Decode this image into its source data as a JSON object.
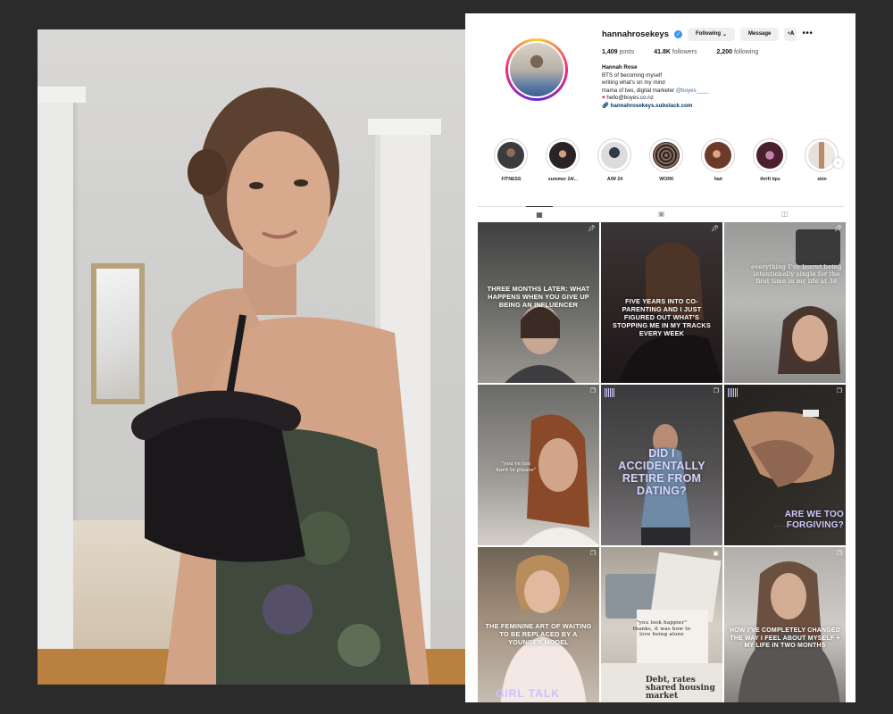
{
  "profile": {
    "username": "hannahrosekeys",
    "following_button": "Following",
    "message_button": "Message",
    "add_person_icon": "add-person",
    "more_icon": "•••",
    "posts_count": "1,409",
    "posts_label": "posts",
    "followers_count": "41.8K",
    "followers_label": "followers",
    "following_count": "2,200",
    "following_label": "following",
    "bio": {
      "name": "Hannah Rose",
      "line1": "BTS of becoming myself",
      "line2": "writing what’s on my mind",
      "line3_text": "mama of two, digital marketer ",
      "line3_mention": "@boyes____",
      "line4_email": "hello@boyes.co.nz",
      "link": "hannahrosekeys.substack.com"
    }
  },
  "highlights": [
    {
      "label": "FITNESS"
    },
    {
      "label": "summer 24/..."
    },
    {
      "label": "A/W 24"
    },
    {
      "label": "WORK"
    },
    {
      "label": "hair"
    },
    {
      "label": "thrift tips"
    },
    {
      "label": "skin"
    }
  ],
  "posts": [
    {
      "text": "THREE MONTHS LATER: WHAT HAPPENS WHEN YOU GIVE UP BEING AN INFLUENCER",
      "icon": "pin"
    },
    {
      "text": "FIVE YEARS INTO CO-PARENTING AND I JUST FIGURED OUT WHAT’S STOPPING ME IN MY TRACKS EVERY WEEK",
      "icon": "pin"
    },
    {
      "text": "everything I’ve learnt being intentionally single for the first time in my life at 38",
      "icon": "pin"
    },
    {
      "text": "\"you’re too hard to please\"",
      "icon": "carousel"
    },
    {
      "text": "DID I ACCIDENTALLY RETIRE FROM DATING?",
      "icon": "carousel"
    },
    {
      "text": "ARE WE TOO FORGIVING?",
      "icon": "carousel"
    },
    {
      "text": "THE FEMININE ART OF WAITING TO BE REPLACED BY A YOUNGER MODEL",
      "icon": "carousel",
      "badge": "GIRL TALK"
    },
    {
      "text": "\"you look happier\" thanks, it was how to love being alone",
      "icon": "reel",
      "badge": "Debt, rates shared housing market"
    },
    {
      "text": "HOW I’VE COMPLETELY CHANGED THE WAY I FEEL ABOUT MYSELF + MY LIFE IN TWO MONTHS",
      "icon": "carousel"
    }
  ]
}
